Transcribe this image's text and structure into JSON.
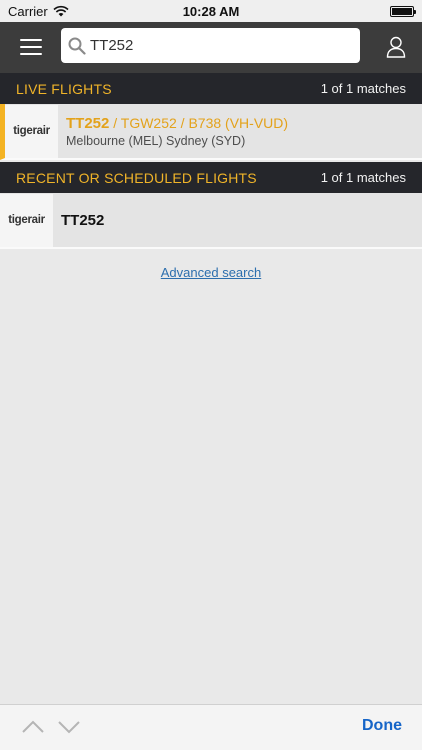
{
  "status_bar": {
    "carrier": "Carrier",
    "time": "10:28 AM"
  },
  "search": {
    "value": "TT252",
    "placeholder": ""
  },
  "live_section": {
    "title": "LIVE FLIGHTS",
    "count": "1 of 1 matches"
  },
  "live_flights": [
    {
      "airline_logo": "tigerair",
      "flight_number": "TT252",
      "details": "/ TGW252 / B738 (VH-VUD)",
      "route": "Melbourne (MEL)  Sydney (SYD)"
    }
  ],
  "recent_section": {
    "title": "RECENT OR SCHEDULED FLIGHTS",
    "count": "1 of 1 matches"
  },
  "recent_flights": [
    {
      "airline_logo": "tigerair",
      "flight_number": "TT252"
    }
  ],
  "advanced_search_label": "Advanced search",
  "toolbar": {
    "done_label": "Done"
  },
  "colors": {
    "header_bg": "#25262b",
    "accent": "#f0b429",
    "topbar_bg": "#3c3c3c",
    "link": "#2d6fae",
    "done": "#1565c8"
  }
}
